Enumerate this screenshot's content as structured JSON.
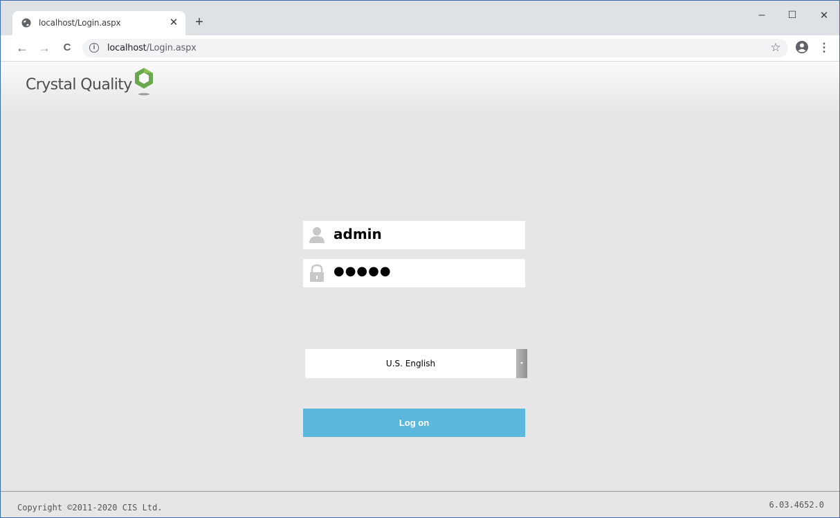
{
  "browser": {
    "tab": {
      "title": "localhost/Login.aspx",
      "close_glyph": "✕"
    },
    "newtab_glyph": "+",
    "window_controls": {
      "minimize": "–",
      "maximize": "☐",
      "close": "✕"
    },
    "nav": {
      "back": "←",
      "forward": "→",
      "reload": "C"
    },
    "address": {
      "info_glyph": "i",
      "host": "localhost",
      "path": "/Login.aspx"
    },
    "toolbar_icons": {
      "star": "☆",
      "menu": "⋮"
    }
  },
  "header": {
    "brand": "Crystal Quality"
  },
  "login": {
    "username": "admin",
    "password_mask": "●●●●●",
    "language": "U.S. English",
    "logon_label": "Log on"
  },
  "footer": {
    "copyright": "Copyright ©2011-2020 CIS Ltd.",
    "version": "6.03.4652.0"
  },
  "colors": {
    "logon_button": "#5bb7dc",
    "logo_green": "#6aa84f",
    "page_background": "#e6e6e6"
  },
  "icons": {
    "favicon": "globe-icon",
    "user": "user-icon",
    "lock": "lock-icon",
    "profile": "account-circle-icon"
  }
}
